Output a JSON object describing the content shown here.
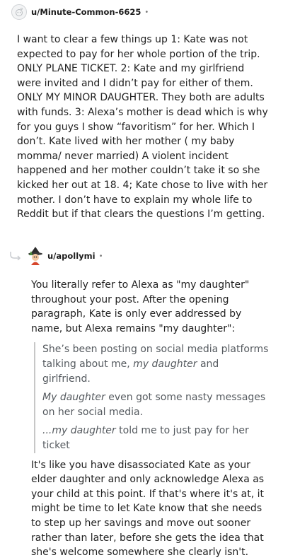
{
  "comment1": {
    "username": "u/Minute-Common-6625",
    "separator": "•",
    "body": "I want to clear a few things up 1: Kate was not expected to pay for her whole portion of the trip. ONLY PLANE TICKET. 2: Kate and my girlfriend were invited and I didn’t pay for either of them. ONLY MY MINOR DAUGHTER. They both are adults with funds. 3: Alexa’s mother is dead which is why for you guys I show “favoritism” for her. Which I don’t. Kate lived with her mother ( my baby momma/ never married) A violent incident happened and her mother couldn’t take it so she kicked her out at 18. 4; Kate chose to live with her mother. I don’t have to explain my whole life to Reddit but if that clears the questions I’m getting."
  },
  "comment2": {
    "username": "u/apollymi",
    "separator": "•",
    "intro": "You literally refer to Alexa as \"my daughter\" throughout your post. After the opening paragraph, Kate is only ever addressed by name, but Alexa remains \"my daughter\":",
    "quote1": {
      "pre": "She’s been posting on social media platforms talking about me, ",
      "em": "my daughter",
      "post": " and girlfriend."
    },
    "quote2": {
      "em": "My daughter",
      "post": " even got some nasty messages on her social media."
    },
    "quote3": {
      "em": "...my daughter",
      "post": " told me to just pay for her ticket"
    },
    "conclusion": "It's like you have disassociated Kate as your elder daughter and only acknowledge Alexa as your child at this point. If that's where it's at, it might be time to let Kate know that she needs to step up her savings and move out sooner rather than later, before she gets the idea that she's welcome somewhere she clearly isn't."
  }
}
